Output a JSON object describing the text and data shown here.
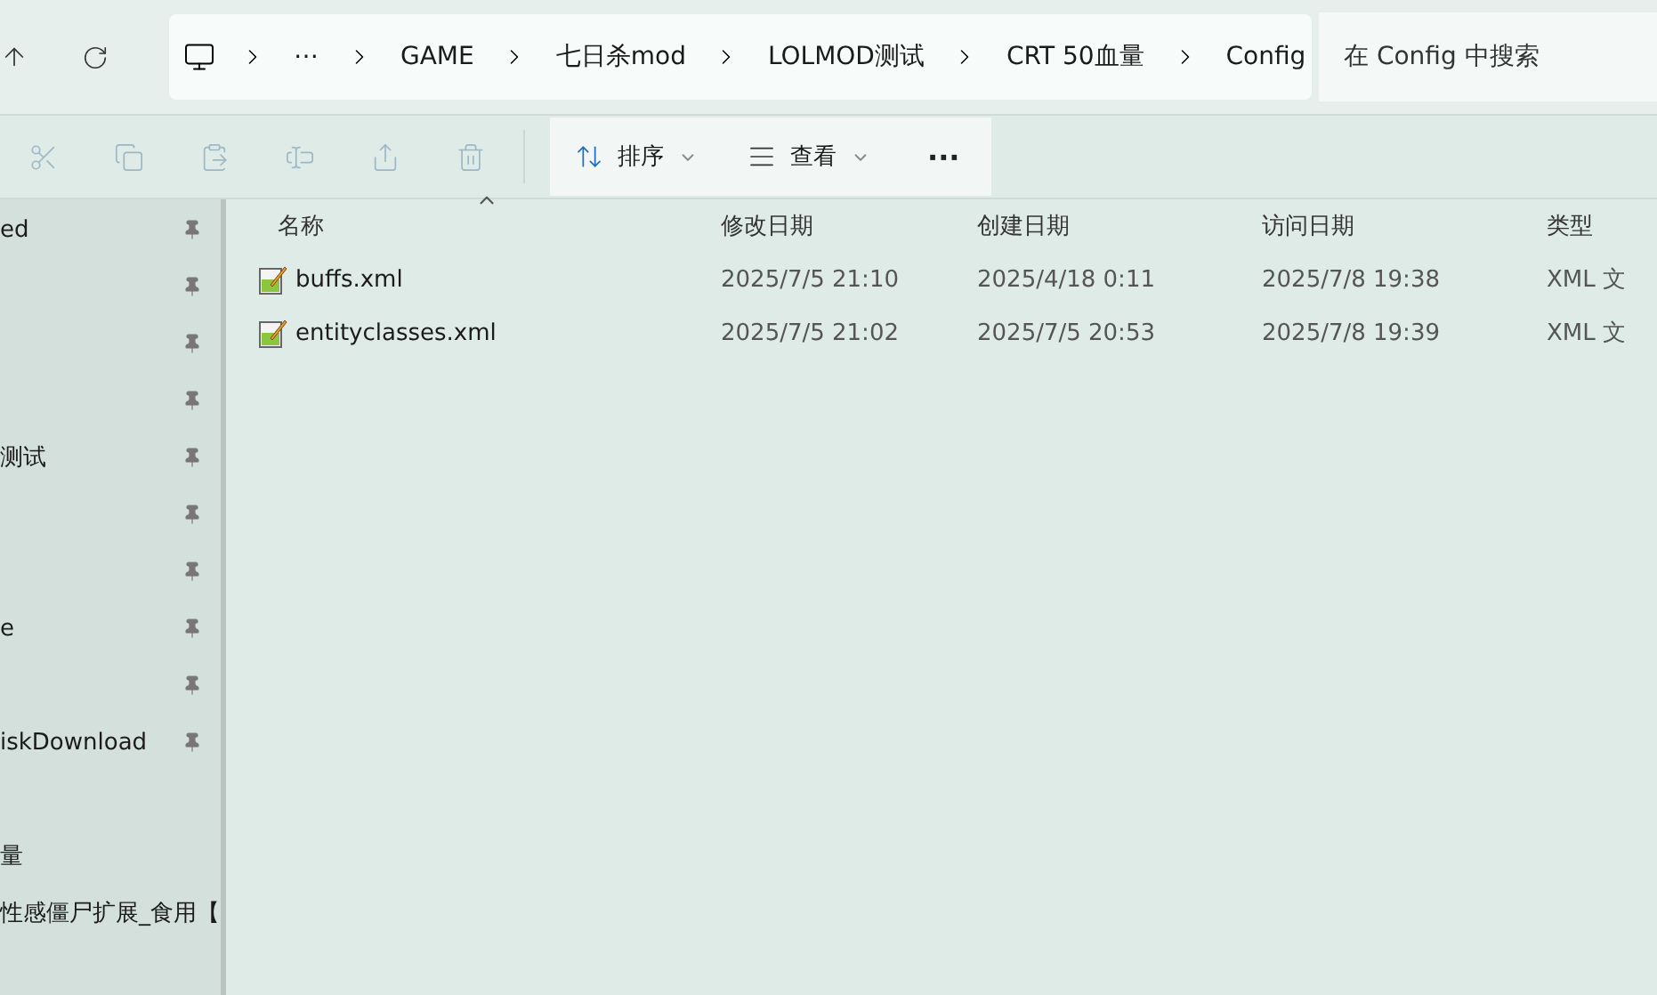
{
  "navigation": {
    "breadcrumb": [
      {
        "label": "⋯"
      },
      {
        "label": "GAME"
      },
      {
        "label": "七日杀mod"
      },
      {
        "label": "LOLMOD测试"
      },
      {
        "label": "CRT 50血量"
      },
      {
        "label": "Config"
      }
    ],
    "search": {
      "placeholder": "在 Config 中搜索"
    }
  },
  "toolbar": {
    "actions": [
      {
        "kind": "cut",
        "disabled": true
      },
      {
        "kind": "copy",
        "disabled": true
      },
      {
        "kind": "paste",
        "disabled": true
      },
      {
        "kind": "rename",
        "disabled": true
      },
      {
        "kind": "share",
        "disabled": true
      },
      {
        "kind": "delete",
        "disabled": true
      }
    ],
    "menus": [
      {
        "kind": "sort",
        "label": "排序"
      },
      {
        "kind": "view",
        "label": "查看"
      }
    ],
    "more": "···"
  },
  "sidebar": {
    "items": [
      {
        "label": "ed",
        "pinned": true
      },
      {
        "pinned": true
      },
      {
        "pinned": true
      },
      {
        "pinned": true
      },
      {
        "label": "测试",
        "pinned": true
      },
      {
        "pinned": true
      },
      {
        "pinned": true
      },
      {
        "label": "e",
        "pinned": true
      },
      {
        "pinned": true
      },
      {
        "label": "iskDownload",
        "pinned": true
      },
      {
        "label": "量",
        "pinned": false
      },
      {
        "label": "性感僵尸扩展_食用【",
        "pinned": false
      }
    ]
  },
  "table": {
    "columns": [
      "名称",
      "修改日期",
      "创建日期",
      "访问日期",
      "类型"
    ],
    "rows": [
      {
        "name": "buffs.xml",
        "modified": "2025/7/5 21:10",
        "created": "2025/4/18 0:11",
        "accessed": "2025/7/8 19:38",
        "type": "XML 文"
      },
      {
        "name": "entityclasses.xml",
        "modified": "2025/7/5 21:02",
        "created": "2025/7/5 20:53",
        "accessed": "2025/7/8 19:39",
        "type": "XML 文"
      }
    ]
  }
}
